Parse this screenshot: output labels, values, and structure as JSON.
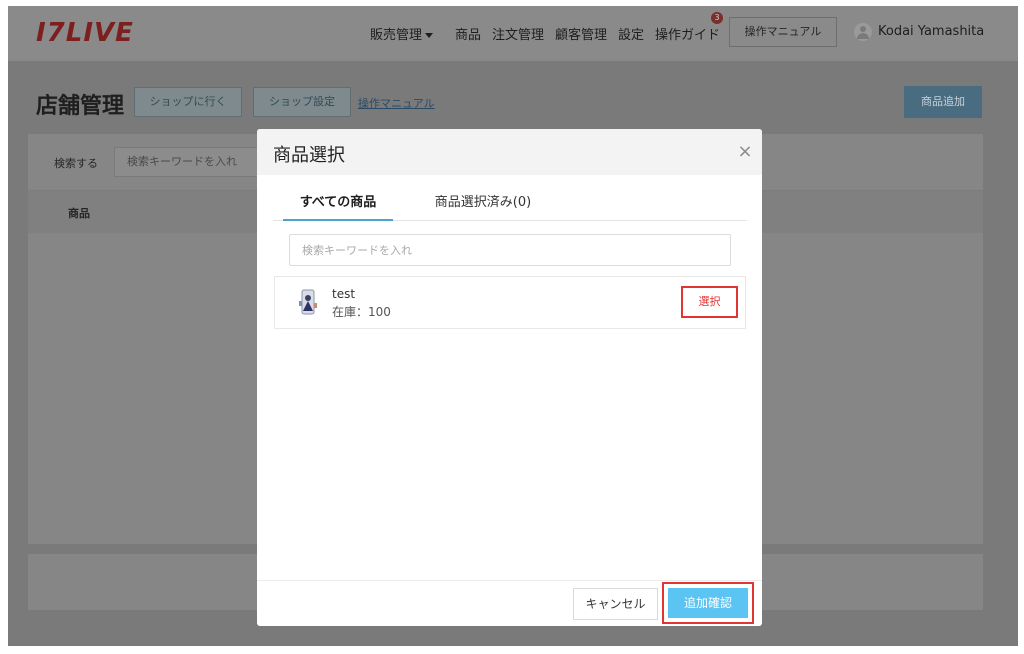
{
  "header": {
    "logo": "I7LIVE",
    "nav": [
      {
        "label": "販売管理"
      },
      {
        "label": "商品"
      },
      {
        "label": "注文管理"
      },
      {
        "label": "顧客管理"
      },
      {
        "label": "設定"
      },
      {
        "label": "操作ガイド"
      }
    ],
    "guide_badge": "3",
    "manual_button": "操作マニュアル",
    "user_name": "Kodai Yamashita"
  },
  "page": {
    "title": "店舗管理",
    "go_shop_button": "ショップに行く",
    "shop_settings_button": "ショップ設定",
    "manual_link": "操作マニュアル",
    "add_product_button": "商品追加",
    "search_label": "検索する",
    "search_placeholder": "検索キーワードを入れ",
    "table_header_product": "商品"
  },
  "modal": {
    "title": "商品選択",
    "close_icon": "×",
    "tabs": [
      {
        "label": "すべての商品",
        "active": true
      },
      {
        "label": "商品選択済み(0)",
        "active": false
      }
    ],
    "search_placeholder": "検索キーワードを入れ",
    "items": [
      {
        "name": "test",
        "stock": "在庫：100",
        "select_label": "選択"
      }
    ],
    "cancel_button": "キャンセル",
    "confirm_button": "追加確認"
  },
  "colors": {
    "accent_blue": "#5bc4f2",
    "highlight_red": "#e33434",
    "tab_underline": "#4da3ce"
  }
}
